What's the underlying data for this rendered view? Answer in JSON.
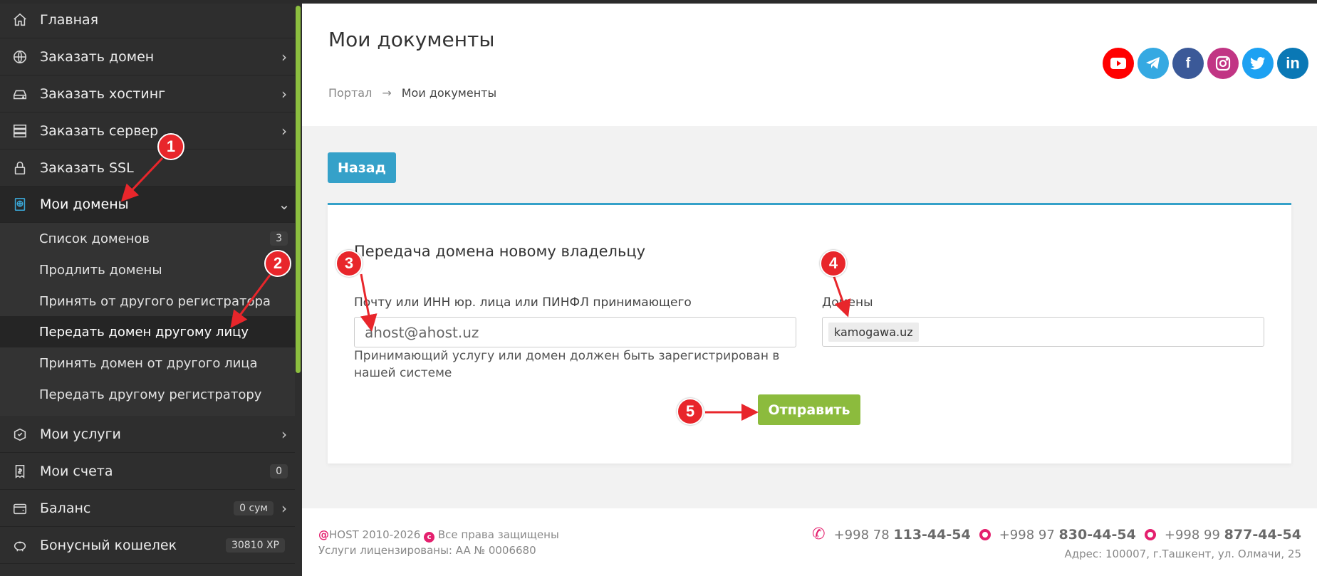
{
  "sidebar": {
    "items": [
      {
        "label": "Главная",
        "icon": "home-icon"
      },
      {
        "label": "Заказать домен",
        "icon": "globe-icon"
      },
      {
        "label": "Заказать хостинг",
        "icon": "hosting-drive-icon"
      },
      {
        "label": "Заказать сервер",
        "icon": "server-icon"
      },
      {
        "label": "Заказать SSL",
        "icon": "lock-icon"
      },
      {
        "label": "Мои домены",
        "icon": "domain-book-icon"
      },
      {
        "label": "Мои услуги",
        "icon": "services-box-icon"
      },
      {
        "label": "Мои счета",
        "icon": "invoice-icon",
        "badge": "0"
      },
      {
        "label": "Баланс",
        "icon": "wallet-icon",
        "badge": "0 сум"
      },
      {
        "label": "Бонусный кошелек",
        "icon": "piggy-bank-icon",
        "badge": "30810 XP"
      }
    ],
    "submenu": [
      {
        "label": "Список доменов",
        "badge": "3"
      },
      {
        "label": "Продлить домены"
      },
      {
        "label": "Принять от другого регистратора"
      },
      {
        "label": "Передать домен другому лицу"
      },
      {
        "label": "Принять домен от другого лица"
      },
      {
        "label": "Передать другому регистратору"
      }
    ]
  },
  "header": {
    "title": "Мои документы",
    "breadcrumb": {
      "home": "Портал",
      "separator": "→",
      "current": "Мои документы"
    },
    "social": [
      {
        "name": "youtube-icon",
        "color": "#ff0000"
      },
      {
        "name": "telegram-icon",
        "color": "#35a9e2"
      },
      {
        "name": "facebook-icon",
        "color": "#3b5998"
      },
      {
        "name": "instagram-icon",
        "color": "#c13584"
      },
      {
        "name": "twitter-icon",
        "color": "#1da1f2"
      },
      {
        "name": "linkedin-icon",
        "color": "#0a78b5"
      }
    ]
  },
  "main": {
    "back_label": "Назад",
    "card": {
      "title": "Передача домена новому владельцу",
      "recipient_label": "Почту или ИНН юр. лица или ПИНФЛ принимающего",
      "recipient_value": "ahost@ahost.uz",
      "help": "Принимающий услугу или домен должен быть зарегистрирован в нашей системе",
      "domains_label": "Домены",
      "domain_tag": "kamogawa.uz",
      "submit_label": "Отправить"
    }
  },
  "footer": {
    "brand_at": "@",
    "brand_text": "HOST 2010-2026",
    "copyright": "Все права защищены",
    "license": "Услуги лицензированы: AA № 0006680",
    "phones": [
      {
        "prefix": "+998 78",
        "number": "113-44-54"
      },
      {
        "prefix": "+998 97",
        "number": "830-44-54"
      },
      {
        "prefix": "+998 99",
        "number": "877-44-54"
      }
    ],
    "address": "Адрес: 100007, г.Ташкент, ул. Олмачи, 25"
  },
  "annotations": [
    "1",
    "2",
    "3",
    "4",
    "5"
  ],
  "colors": {
    "accent": "#35a1c9",
    "submit": "#8cbb3d",
    "marker": "#e8262b",
    "brand": "#e4206e"
  }
}
